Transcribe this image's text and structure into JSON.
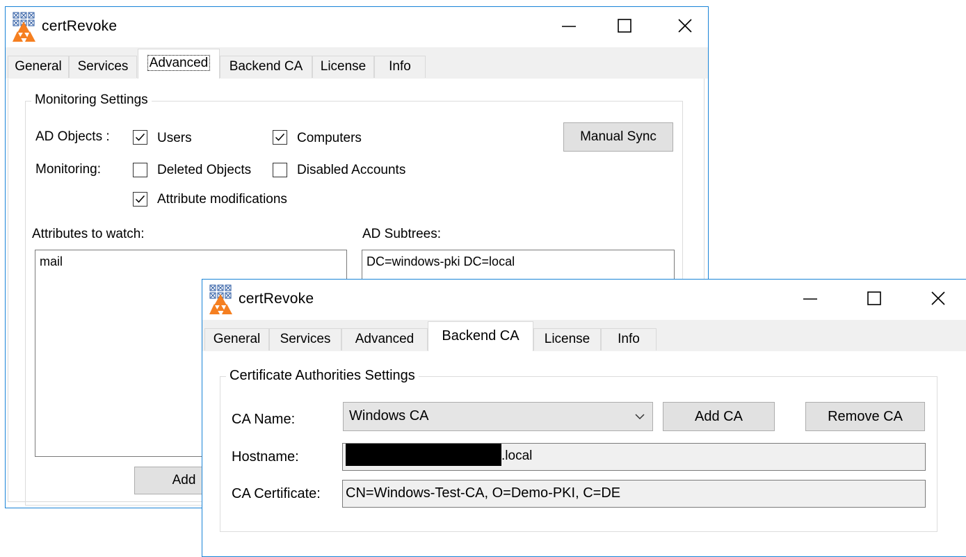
{
  "colors": {
    "window_border": "#1883d7",
    "button_face": "#e1e1e1",
    "tab_strip": "#f0f0f0",
    "logo_orange": "#f57f20",
    "logo_blue": "#1e4f9c"
  },
  "back_window": {
    "title": "certRevoke",
    "controls": {
      "minimize_icon": "minimize-icon",
      "maximize_icon": "maximize-icon",
      "close_icon": "close-icon"
    },
    "tabs": [
      {
        "label": "General",
        "selected": false
      },
      {
        "label": "Services",
        "selected": false
      },
      {
        "label": "Advanced",
        "selected": true
      },
      {
        "label": "Backend CA",
        "selected": false
      },
      {
        "label": "License",
        "selected": false
      },
      {
        "label": "Info",
        "selected": false
      }
    ],
    "monitoring": {
      "group_title": "Monitoring Settings",
      "ad_objects_label": "AD Objects :",
      "monitoring_label": "Monitoring:",
      "users": {
        "label": "Users",
        "checked": true
      },
      "computers": {
        "label": "Computers",
        "checked": true
      },
      "deleted_objects": {
        "label": "Deleted Objects",
        "checked": false
      },
      "disabled_accounts": {
        "label": "Disabled Accounts",
        "checked": false
      },
      "attribute_modifications": {
        "label": "Attribute modifications",
        "checked": true
      },
      "manual_sync_label": "Manual Sync",
      "attributes_label": "Attributes to watch:",
      "attributes": [
        "mail"
      ],
      "subtrees_label": "AD Subtrees:",
      "subtrees": [
        "DC=windows-pki DC=local"
      ],
      "add_label": "Add"
    }
  },
  "front_window": {
    "title": "certRevoke",
    "tabs": [
      {
        "label": "General",
        "selected": false
      },
      {
        "label": "Services",
        "selected": false
      },
      {
        "label": "Advanced",
        "selected": false
      },
      {
        "label": "Backend CA",
        "selected": true
      },
      {
        "label": "License",
        "selected": false
      },
      {
        "label": "Info",
        "selected": false
      }
    ],
    "ca_settings": {
      "group_title": "Certificate Authorities Settings",
      "ca_name_label": "CA Name:",
      "ca_name_value": "Windows CA",
      "add_ca_label": "Add CA",
      "remove_ca_label": "Remove CA",
      "hostname_label": "Hostname:",
      "hostname_suffix": ".local",
      "ca_cert_label": "CA Certificate:",
      "ca_cert_value": "CN=Windows-Test-CA, O=Demo-PKI, C=DE"
    }
  }
}
